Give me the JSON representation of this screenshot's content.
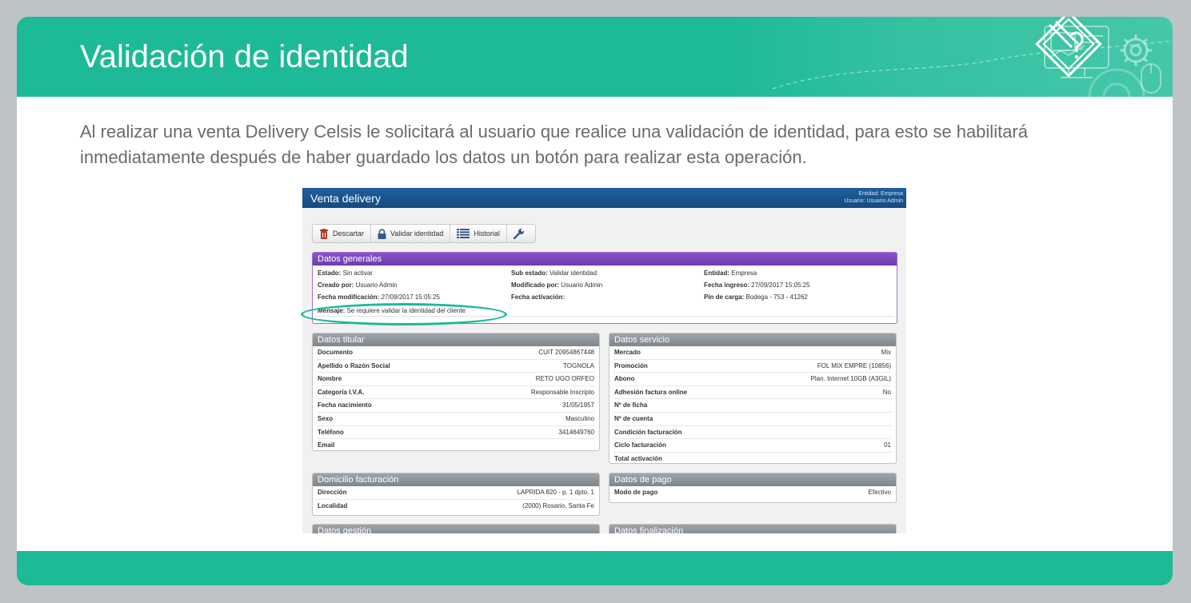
{
  "slide": {
    "title": "Validación de identidad",
    "intro": "Al realizar una venta Delivery Celsis le solicitará al usuario que realice una validación de identidad, para esto se habilitará inmediatamente después de haber guardado los datos un botón para realizar esta operación.",
    "accent_color": "#1dba97"
  },
  "app": {
    "title": "Venta delivery",
    "entity_line": "Entidad: Empresa",
    "user_line": "Usuario: Usuario Admin",
    "toolbar": {
      "discard": "Descartar",
      "validate": "Validar identidad",
      "history": "Historial",
      "tools_icon": "wrench-icon"
    },
    "general": {
      "header": "Datos generales",
      "estado_k": "Estado:",
      "estado_v": "Sin activar",
      "subestado_k": "Sub estado:",
      "subestado_v": "Validar identidad",
      "entidad_k": "Entidad:",
      "entidad_v": "Empresa",
      "creado_k": "Creado por:",
      "creado_v": "Usuario Admin",
      "modificado_k": "Modificado por:",
      "modificado_v": "Usuario Admin",
      "ingreso_k": "Fecha ingreso:",
      "ingreso_v": "27/09/2017 15:05:25",
      "fmod_k": "Fecha modificación:",
      "fmod_v": "27/09/2017 15:05:25",
      "factiv_k": "Fecha activación:",
      "factiv_v": "",
      "pin_k": "Pin de carga:",
      "pin_v": "Bodega - 753 - 41262",
      "mensaje_k": "Mensaje:",
      "mensaje_v": "Se requiere validar la identidad del cliente"
    },
    "titular": {
      "header": "Datos titular",
      "rows": [
        {
          "k": "Documento",
          "v": "CUIT 20954867448"
        },
        {
          "k": "Apellido o Razón Social",
          "v": "TOGNOLA"
        },
        {
          "k": "Nombre",
          "v": "RETO UGO ORFEO"
        },
        {
          "k": "Categoría I.V.A.",
          "v": "Responsable Inscripto"
        },
        {
          "k": "Fecha nacimiento",
          "v": "31/05/1957"
        },
        {
          "k": "Sexo",
          "v": "Masculino"
        },
        {
          "k": "Teléfono",
          "v": "3414649760"
        },
        {
          "k": "Email",
          "v": ""
        }
      ]
    },
    "servicio": {
      "header": "Datos servicio",
      "rows": [
        {
          "k": "Mercado",
          "v": "Mix"
        },
        {
          "k": "Promoción",
          "v": "FOL MIX EMPRE (10856)"
        },
        {
          "k": "Abono",
          "v": "Plan. Internet 10GB (A3GIL)"
        },
        {
          "k": "Adhesión factura online",
          "v": "No"
        },
        {
          "k": "Nº de ficha",
          "v": ""
        },
        {
          "k": "Nº de cuenta",
          "v": ""
        },
        {
          "k": "Condición facturación",
          "v": ""
        },
        {
          "k": "Ciclo facturación",
          "v": "01"
        },
        {
          "k": "Total activación",
          "v": ""
        }
      ]
    },
    "domicilio": {
      "header": "Domicilio facturación",
      "rows": [
        {
          "k": "Dirección",
          "v": "LAPRIDA 820 - p. 1 dpto. 1"
        },
        {
          "k": "Localidad",
          "v": "(2000) Rosario, Santa Fe"
        }
      ]
    },
    "pago": {
      "header": "Datos de pago",
      "rows": [
        {
          "k": "Modo de pago",
          "v": "Efectivo"
        }
      ]
    },
    "gestion": {
      "header": "Datos gestión"
    },
    "finalizacion": {
      "header": "Datos finalización"
    }
  }
}
